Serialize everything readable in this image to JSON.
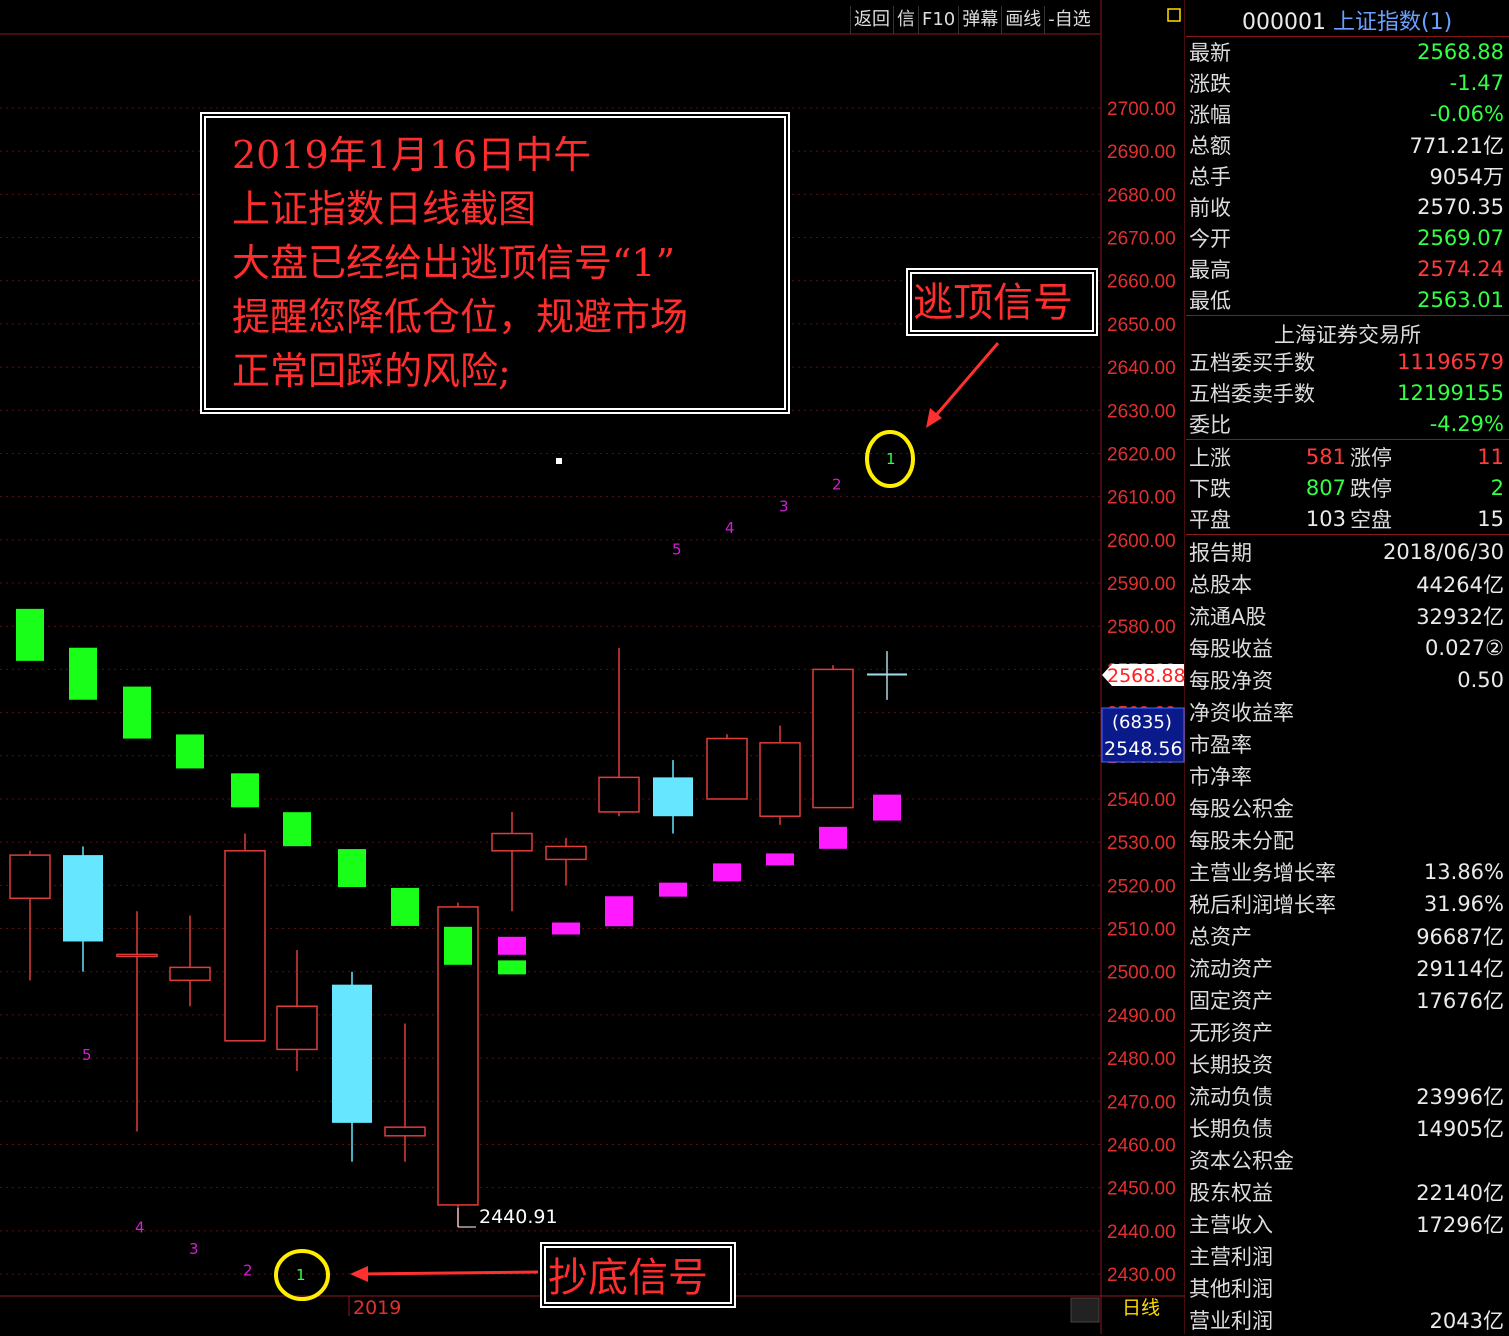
{
  "chart_toolbar": {
    "items": [
      "返回",
      "信",
      "F10",
      "弹幕",
      "画线",
      "-自选"
    ]
  },
  "chart_labels": {
    "year_label": "2019",
    "period_label": "日线",
    "low_label": "2440.91",
    "current_price_tag": "2568.88",
    "crosshair_count": "(6835)",
    "crosshair_price": "2548.56"
  },
  "annotation": {
    "lines": [
      "2019年1月16日中午",
      "上证指数日线截图",
      "大盘已经给出逃顶信号“1”",
      "提醒您降低仓位，规避市场",
      "正常回踩的风险;"
    ],
    "top_signal_label": "逃顶信号",
    "bottom_signal_label": "抄底信号"
  },
  "chart_data": {
    "type": "candlestick",
    "y_axis": {
      "min": 2430,
      "max": 2700,
      "ticks": [
        "2700.00",
        "2690.00",
        "2680.00",
        "2670.00",
        "2660.00",
        "2650.00",
        "2640.00",
        "2630.00",
        "2620.00",
        "2610.00",
        "2600.00",
        "2590.00",
        "2580.00",
        "2570.00",
        "2560.00",
        "2550.00",
        "2540.00",
        "2530.00",
        "2520.00",
        "2510.00",
        "2500.00",
        "2490.00",
        "2480.00",
        "2470.00",
        "2460.00",
        "2450.00",
        "2440.00",
        "2430.00"
      ]
    },
    "candles": [
      {
        "o": 2517,
        "c": 2527,
        "h": 2528,
        "l": 2498
      },
      {
        "o": 2527,
        "c": 2507,
        "h": 2529,
        "l": 2500
      },
      {
        "o": 2504,
        "c": 2504,
        "h": 2514,
        "l": 2463
      },
      {
        "o": 2498,
        "c": 2501,
        "h": 2513,
        "l": 2492
      },
      {
        "o": 2484,
        "c": 2528,
        "h": 2532,
        "l": 2484
      },
      {
        "o": 2482,
        "c": 2492,
        "h": 2505,
        "l": 2477
      },
      {
        "o": 2497,
        "c": 2465,
        "h": 2500,
        "l": 2456
      },
      {
        "o": 2462,
        "c": 2464,
        "h": 2488,
        "l": 2456
      },
      {
        "o": 2446,
        "c": 2515,
        "h": 2516,
        "l": 2440.91
      },
      {
        "o": 2528,
        "c": 2532,
        "h": 2537,
        "l": 2514
      },
      {
        "o": 2526,
        "c": 2529,
        "h": 2531,
        "l": 2520
      },
      {
        "o": 2537,
        "c": 2545,
        "h": 2575,
        "l": 2536
      },
      {
        "o": 2545,
        "c": 2536,
        "h": 2549,
        "l": 2532
      },
      {
        "o": 2540,
        "c": 2554,
        "h": 2555,
        "l": 2540
      },
      {
        "o": 2536,
        "c": 2553,
        "h": 2557,
        "l": 2534
      },
      {
        "o": 2538,
        "c": 2570,
        "h": 2571,
        "l": 2538
      },
      {
        "o": 2569.07,
        "c": 2568.88,
        "h": 2574.24,
        "l": 2563.01
      }
    ],
    "green_markers": [
      2578,
      2569,
      2560,
      2551,
      2542,
      2533,
      2524,
      2515,
      2506,
      2501
    ],
    "magenta_markers": [
      2506,
      2510,
      2514,
      2519,
      2523,
      2526,
      2531,
      2538
    ],
    "sequence_numbers_top": [
      {
        "n": "5",
        "v": 2598
      },
      {
        "n": "4",
        "v": 2603
      },
      {
        "n": "3",
        "v": 2608
      },
      {
        "n": "2",
        "v": 2613
      },
      {
        "n": "1",
        "v": 2619
      }
    ],
    "sequence_numbers_bottom": [
      {
        "n": "5",
        "v": 2481
      },
      {
        "n": "4",
        "v": 2441
      },
      {
        "n": "3",
        "v": 2436
      },
      {
        "n": "2",
        "v": 2431
      },
      {
        "n": "1",
        "v": 2430
      }
    ]
  },
  "quote": {
    "code": "000001",
    "name": "上证指数(1)",
    "rows": [
      {
        "label": "最新",
        "value": "2568.88",
        "color": "g"
      },
      {
        "label": "涨跌",
        "value": "-1.47",
        "color": "g"
      },
      {
        "label": "涨幅",
        "value": "-0.06%",
        "color": "g"
      },
      {
        "label": "总额",
        "value": "771.21亿",
        "color": "w"
      },
      {
        "label": "总手",
        "value": "9054万",
        "color": "w"
      },
      {
        "label": "前收",
        "value": "2570.35",
        "color": "w"
      },
      {
        "label": "今开",
        "value": "2569.07",
        "color": "g"
      },
      {
        "label": "最高",
        "value": "2574.24",
        "color": "r"
      },
      {
        "label": "最低",
        "value": "2563.01",
        "color": "g"
      }
    ],
    "exchange": "上海证券交易所",
    "order_rows": [
      {
        "label": "五档委买手数",
        "value": "11196579",
        "color": "r"
      },
      {
        "label": "五档委卖手数",
        "value": "12199155",
        "color": "g"
      },
      {
        "label": "委比",
        "value": "-4.29%",
        "color": "g"
      }
    ],
    "breadth": [
      {
        "l1": "上涨",
        "v1": "581",
        "c1": "r",
        "l2": "涨停",
        "v2": "11",
        "c2": "r"
      },
      {
        "l1": "下跌",
        "v1": "807",
        "c1": "g",
        "l2": "跌停",
        "v2": "2",
        "c2": "g"
      },
      {
        "l1": "平盘",
        "v1": "103",
        "c1": "w",
        "l2": "空盘",
        "v2": "15",
        "c2": "w"
      }
    ],
    "fundamentals": [
      {
        "label": "报告期",
        "value": "2018/06/30"
      },
      {
        "label": "总股本",
        "value": "44264亿"
      },
      {
        "label": "流通A股",
        "value": "32932亿"
      },
      {
        "label": "每股收益",
        "value": "0.027②"
      },
      {
        "label": "每股净资",
        "value": "0.50"
      },
      {
        "label": "净资收益率",
        "value": ""
      },
      {
        "label": "市盈率",
        "value": ""
      },
      {
        "label": "市净率",
        "value": ""
      },
      {
        "label": "每股公积金",
        "value": ""
      },
      {
        "label": "每股未分配",
        "value": ""
      },
      {
        "label": "主营业务增长率",
        "value": "13.86%"
      },
      {
        "label": "税后利润增长率",
        "value": "31.96%"
      },
      {
        "label": "总资产",
        "value": "96687亿"
      },
      {
        "label": "流动资产",
        "value": "29114亿"
      },
      {
        "label": "固定资产",
        "value": "17676亿"
      },
      {
        "label": "无形资产",
        "value": ""
      },
      {
        "label": "长期投资",
        "value": ""
      },
      {
        "label": "流动负债",
        "value": "23996亿"
      },
      {
        "label": "长期负债",
        "value": "14905亿"
      },
      {
        "label": "资本公积金",
        "value": ""
      },
      {
        "label": "股东权益",
        "value": "22140亿"
      },
      {
        "label": "主营收入",
        "value": "17296亿"
      },
      {
        "label": "主营利润",
        "value": ""
      },
      {
        "label": "其他利润",
        "value": ""
      },
      {
        "label": "营业利润",
        "value": "2043亿"
      }
    ]
  }
}
